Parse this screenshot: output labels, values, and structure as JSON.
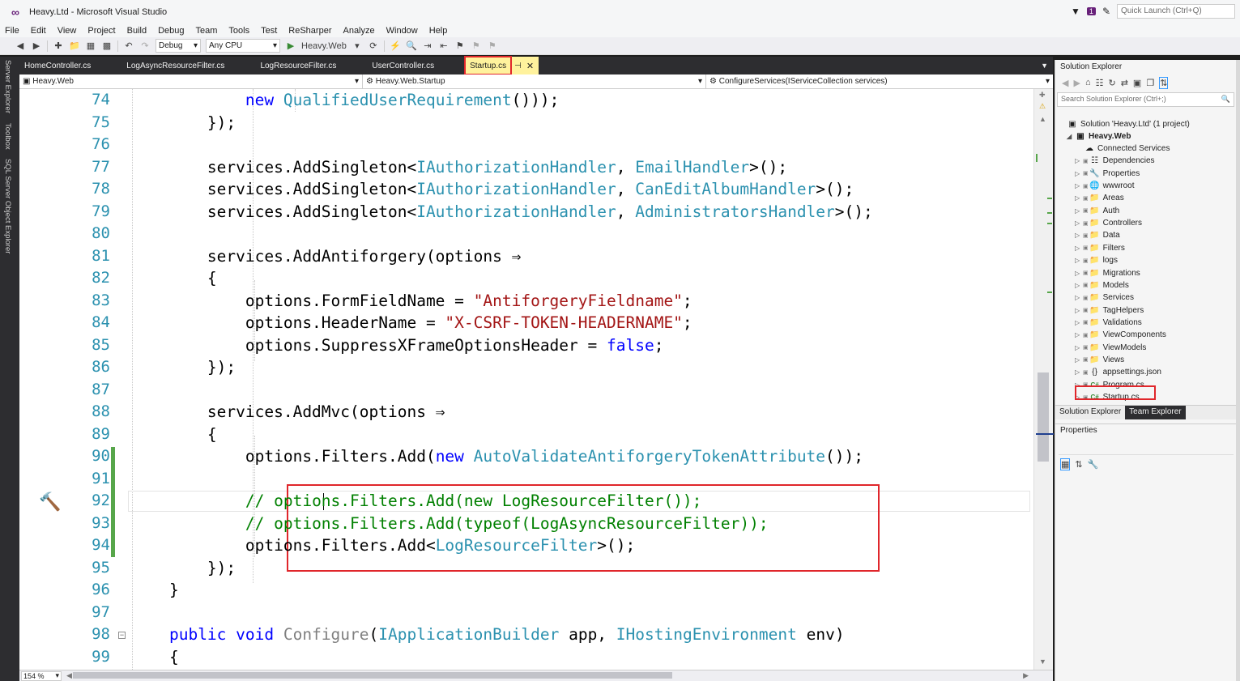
{
  "window": {
    "title": "Heavy.Ltd - Microsoft Visual Studio",
    "logo": "vs-logo-icon",
    "notification_count": "1",
    "quick_launch_placeholder": "Quick Launch (Ctrl+Q)"
  },
  "menu": [
    "File",
    "Edit",
    "View",
    "Project",
    "Build",
    "Debug",
    "Team",
    "Tools",
    "Test",
    "ReSharper",
    "Analyze",
    "Window",
    "Help"
  ],
  "toolbar": {
    "config": "Debug",
    "platform": "Any CPU",
    "run_label": "Heavy.Web"
  },
  "side_tabs": [
    "Server Explorer",
    "Toolbox",
    "SQL Server Object Explorer"
  ],
  "tabs": {
    "items": [
      "HomeController.cs",
      "LogAsyncResourceFilter.cs",
      "LogResourceFilter.cs",
      "UserController.cs"
    ],
    "active": "Startup.cs"
  },
  "nav": {
    "project": "Heavy.Web",
    "type": "Heavy.Web.Startup",
    "member": "ConfigureServices(IServiceCollection services)"
  },
  "editor": {
    "zoom": "154 %",
    "lines": [
      {
        "n": "74",
        "tokens": [
          [
            "",
            "            "
          ],
          [
            "kw",
            "new "
          ],
          [
            "ty",
            "QualifiedUserRequirement"
          ],
          [
            "",
            "()));"
          ]
        ]
      },
      {
        "n": "75",
        "tokens": [
          [
            "",
            "        });"
          ]
        ]
      },
      {
        "n": "76",
        "tokens": []
      },
      {
        "n": "77",
        "tokens": [
          [
            "",
            "        services.AddSingleton<"
          ],
          [
            "ty",
            "IAuthorizationHandler"
          ],
          [
            "",
            ", "
          ],
          [
            "ty",
            "EmailHandler"
          ],
          [
            "",
            ">();"
          ]
        ]
      },
      {
        "n": "78",
        "tokens": [
          [
            "",
            "        services.AddSingleton<"
          ],
          [
            "ty",
            "IAuthorizationHandler"
          ],
          [
            "",
            ", "
          ],
          [
            "ty",
            "CanEditAlbumHandler"
          ],
          [
            "",
            ">();"
          ]
        ]
      },
      {
        "n": "79",
        "tokens": [
          [
            "",
            "        services.AddSingleton<"
          ],
          [
            "ty",
            "IAuthorizationHandler"
          ],
          [
            "",
            ", "
          ],
          [
            "ty",
            "AdministratorsHandler"
          ],
          [
            "",
            ">();"
          ]
        ]
      },
      {
        "n": "80",
        "tokens": []
      },
      {
        "n": "81",
        "tokens": [
          [
            "",
            "        services.AddAntiforgery(options ⇒"
          ]
        ]
      },
      {
        "n": "82",
        "tokens": [
          [
            "",
            "        {"
          ]
        ]
      },
      {
        "n": "83",
        "tokens": [
          [
            "",
            "            options.FormFieldName = "
          ],
          [
            "st",
            "\"AntiforgeryFieldname\""
          ],
          [
            "",
            ";"
          ]
        ]
      },
      {
        "n": "84",
        "tokens": [
          [
            "",
            "            options.HeaderName = "
          ],
          [
            "st",
            "\"X-CSRF-TOKEN-HEADERNAME\""
          ],
          [
            "",
            ";"
          ]
        ]
      },
      {
        "n": "85",
        "tokens": [
          [
            "",
            "            options.SuppressXFrameOptionsHeader = "
          ],
          [
            "kw",
            "false"
          ],
          [
            "",
            ";"
          ]
        ]
      },
      {
        "n": "86",
        "tokens": [
          [
            "",
            "        });"
          ]
        ]
      },
      {
        "n": "87",
        "tokens": []
      },
      {
        "n": "88",
        "tokens": [
          [
            "",
            "        services.AddMvc(options ⇒"
          ]
        ]
      },
      {
        "n": "89",
        "tokens": [
          [
            "",
            "        {"
          ]
        ]
      },
      {
        "n": "90",
        "tokens": [
          [
            "",
            "            options.Filters.Add("
          ],
          [
            "kw",
            "new "
          ],
          [
            "ty",
            "AutoValidateAntiforgeryTokenAttribute"
          ],
          [
            "",
            "());"
          ]
        ]
      },
      {
        "n": "91",
        "tokens": []
      },
      {
        "n": "92",
        "tokens": [
          [
            "",
            "            "
          ],
          [
            "cm",
            "// options.Filters.Add(new LogResourceFilter());"
          ]
        ]
      },
      {
        "n": "93",
        "tokens": [
          [
            "",
            "            "
          ],
          [
            "cm",
            "// options.Filters.Add(typeof(LogAsyncResourceFilter));"
          ]
        ]
      },
      {
        "n": "94",
        "tokens": [
          [
            "",
            "            options.Filters.Add<"
          ],
          [
            "ty",
            "LogResourceFilter"
          ],
          [
            "",
            ">();"
          ]
        ]
      },
      {
        "n": "95",
        "tokens": [
          [
            "",
            "        });"
          ]
        ]
      },
      {
        "n": "96",
        "tokens": [
          [
            "",
            "    }"
          ]
        ]
      },
      {
        "n": "97",
        "tokens": []
      },
      {
        "n": "98",
        "tokens": [
          [
            "",
            "    "
          ],
          [
            "kw",
            "public void "
          ],
          [
            "gr",
            "Configure"
          ],
          [
            "",
            "("
          ],
          [
            "ty",
            "IApplicationBuilder"
          ],
          [
            "",
            " app, "
          ],
          [
            "ty",
            "IHostingEnvironment"
          ],
          [
            "",
            " env)"
          ]
        ]
      },
      {
        "n": "99",
        "tokens": [
          [
            "",
            "    {"
          ]
        ]
      }
    ]
  },
  "solution_explorer": {
    "title": "Solution Explorer",
    "search_placeholder": "Search Solution Explorer (Ctrl+;)",
    "solution": "Solution 'Heavy.Ltd' (1 project)",
    "project": "Heavy.Web",
    "items": [
      {
        "label": "Connected Services",
        "icon": "connected-services-icon",
        "arrow": false
      },
      {
        "label": "Dependencies",
        "icon": "dependencies-icon",
        "arrow": true
      },
      {
        "label": "Properties",
        "icon": "wrench-icon",
        "arrow": true
      },
      {
        "label": "wwwroot",
        "icon": "globe-icon",
        "arrow": true
      },
      {
        "label": "Areas",
        "icon": "folder-icon",
        "arrow": true
      },
      {
        "label": "Auth",
        "icon": "folder-icon",
        "arrow": true
      },
      {
        "label": "Controllers",
        "icon": "folder-icon",
        "arrow": true
      },
      {
        "label": "Data",
        "icon": "folder-icon",
        "arrow": true
      },
      {
        "label": "Filters",
        "icon": "folder-icon",
        "arrow": true
      },
      {
        "label": "logs",
        "icon": "folder-icon",
        "arrow": true
      },
      {
        "label": "Migrations",
        "icon": "folder-icon",
        "arrow": true
      },
      {
        "label": "Models",
        "icon": "folder-icon",
        "arrow": true
      },
      {
        "label": "Services",
        "icon": "folder-icon",
        "arrow": true
      },
      {
        "label": "TagHelpers",
        "icon": "folder-icon",
        "arrow": true
      },
      {
        "label": "Validations",
        "icon": "folder-icon",
        "arrow": true
      },
      {
        "label": "ViewComponents",
        "icon": "folder-icon",
        "arrow": true
      },
      {
        "label": "ViewModels",
        "icon": "folder-icon",
        "arrow": true
      },
      {
        "label": "Views",
        "icon": "folder-icon",
        "arrow": true
      },
      {
        "label": "appsettings.json",
        "icon": "json-icon",
        "arrow": true
      },
      {
        "label": "Program.cs",
        "icon": "csharp-file-icon",
        "arrow": true
      },
      {
        "label": "Startup.cs",
        "icon": "csharp-file-icon",
        "arrow": true
      }
    ],
    "tabs": [
      "Solution Explorer",
      "Team Explorer"
    ]
  },
  "properties": {
    "title": "Properties"
  }
}
